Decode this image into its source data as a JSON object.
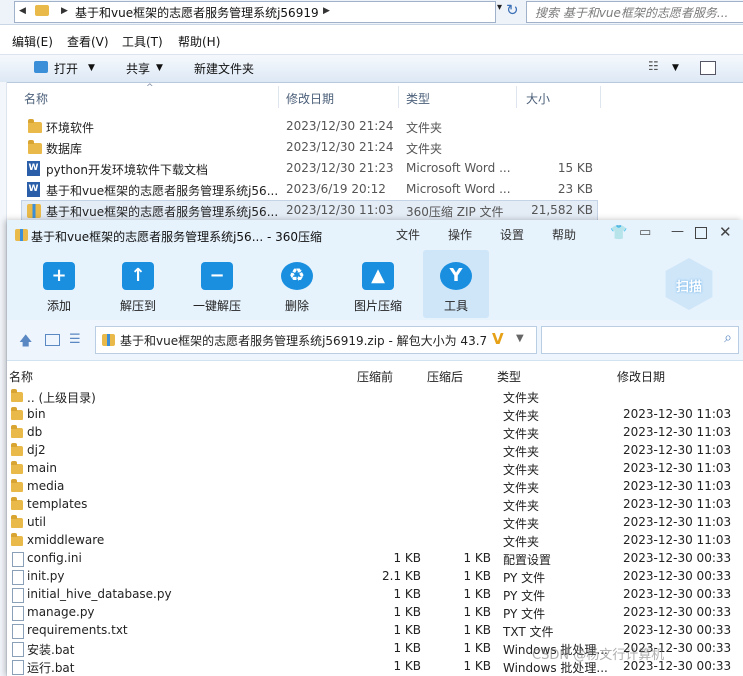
{
  "explorer": {
    "breadcrumb": "基于和vue框架的志愿者服务管理系统j56919",
    "search_placeholder": "搜索 基于和vue框架的志愿者服务...",
    "menu": [
      "编辑(E)",
      "查看(V)",
      "工具(T)",
      "帮助(H)"
    ],
    "toolbar": {
      "open": "打开",
      "share": "共享",
      "new_folder": "新建文件夹"
    },
    "columns": {
      "name": "名称",
      "modified": "修改日期",
      "type": "类型",
      "size": "大小"
    },
    "rows": [
      {
        "name": "环境软件",
        "date": "2023/12/30 21:24",
        "type": "文件夹",
        "size": "",
        "icon": "folder"
      },
      {
        "name": "数据库",
        "date": "2023/12/30 21:24",
        "type": "文件夹",
        "size": "",
        "icon": "folder"
      },
      {
        "name": "python开发环境软件下载文档",
        "date": "2023/12/30 21:23",
        "type": "Microsoft Word ...",
        "size": "15 KB",
        "icon": "word"
      },
      {
        "name": "基于和vue框架的志愿者服务管理系统j56...",
        "date": "2023/6/19 20:12",
        "type": "Microsoft Word ...",
        "size": "23 KB",
        "icon": "word"
      },
      {
        "name": "基于和vue框架的志愿者服务管理系统j56...",
        "date": "2023/12/30 11:03",
        "type": "360压缩 ZIP 文件",
        "size": "21,582 KB",
        "icon": "zip",
        "selected": true
      }
    ]
  },
  "zip": {
    "title": "基于和vue框架的志愿者服务管理系统j56... - 360压缩",
    "menu": [
      "文件",
      "操作",
      "设置",
      "帮助"
    ],
    "tools": [
      {
        "label": "添加",
        "icon": "add-icon"
      },
      {
        "label": "解压到",
        "icon": "extract-to-icon"
      },
      {
        "label": "一键解压",
        "icon": "one-click-extract-icon"
      },
      {
        "label": "删除",
        "icon": "delete-icon"
      },
      {
        "label": "图片压缩",
        "icon": "image-compress-icon"
      },
      {
        "label": "工具",
        "icon": "tools-icon",
        "active": true
      }
    ],
    "scan_label": "扫描",
    "path": "基于和vue框架的志愿者服务管理系统j56919.zip - 解包大小为 43.7 MB",
    "columns": {
      "name": "名称",
      "packed": "压缩前",
      "unpacked": "压缩后",
      "type": "类型",
      "modified": "修改日期"
    },
    "rows": [
      {
        "name": ".. (上级目录)",
        "packed": "",
        "unpacked": "",
        "type": "文件夹",
        "date": "",
        "icon": "folder"
      },
      {
        "name": "bin",
        "packed": "",
        "unpacked": "",
        "type": "文件夹",
        "date": "2023-12-30 11:03",
        "icon": "folder"
      },
      {
        "name": "db",
        "packed": "",
        "unpacked": "",
        "type": "文件夹",
        "date": "2023-12-30 11:03",
        "icon": "folder"
      },
      {
        "name": "dj2",
        "packed": "",
        "unpacked": "",
        "type": "文件夹",
        "date": "2023-12-30 11:03",
        "icon": "folder"
      },
      {
        "name": "main",
        "packed": "",
        "unpacked": "",
        "type": "文件夹",
        "date": "2023-12-30 11:03",
        "icon": "folder"
      },
      {
        "name": "media",
        "packed": "",
        "unpacked": "",
        "type": "文件夹",
        "date": "2023-12-30 11:03",
        "icon": "folder"
      },
      {
        "name": "templates",
        "packed": "",
        "unpacked": "",
        "type": "文件夹",
        "date": "2023-12-30 11:03",
        "icon": "folder"
      },
      {
        "name": "util",
        "packed": "",
        "unpacked": "",
        "type": "文件夹",
        "date": "2023-12-30 11:03",
        "icon": "folder"
      },
      {
        "name": "xmiddleware",
        "packed": "",
        "unpacked": "",
        "type": "文件夹",
        "date": "2023-12-30 11:03",
        "icon": "folder"
      },
      {
        "name": "config.ini",
        "packed": "1 KB",
        "unpacked": "1 KB",
        "type": "配置设置",
        "date": "2023-12-30 00:33",
        "icon": "file"
      },
      {
        "name": "init.py",
        "packed": "2.1 KB",
        "unpacked": "1 KB",
        "type": "PY 文件",
        "date": "2023-12-30 00:33",
        "icon": "file"
      },
      {
        "name": "initial_hive_database.py",
        "packed": "1 KB",
        "unpacked": "1 KB",
        "type": "PY 文件",
        "date": "2023-12-30 00:33",
        "icon": "file"
      },
      {
        "name": "manage.py",
        "packed": "1 KB",
        "unpacked": "1 KB",
        "type": "PY 文件",
        "date": "2023-12-30 00:33",
        "icon": "file"
      },
      {
        "name": "requirements.txt",
        "packed": "1 KB",
        "unpacked": "1 KB",
        "type": "TXT 文件",
        "date": "2023-12-30 00:33",
        "icon": "file"
      },
      {
        "name": "安装.bat",
        "packed": "1 KB",
        "unpacked": "1 KB",
        "type": "Windows 批处理...",
        "date": "2023-12-30 00:33",
        "icon": "file"
      },
      {
        "name": "运行.bat",
        "packed": "1 KB",
        "unpacked": "1 KB",
        "type": "Windows 批处理...",
        "date": "2023-12-30 00:33",
        "icon": "file"
      }
    ]
  },
  "watermark": "CSDN @杨文行计算机"
}
